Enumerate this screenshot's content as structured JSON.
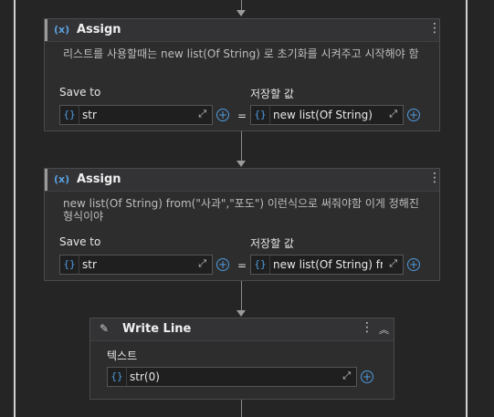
{
  "assign1": {
    "title": "Assign",
    "icon": "variable-x-icon",
    "description": "리스트를 사용할때는 new list(Of String) 로 초기화를 시켜주고 시작해야 함",
    "save_to_label": "Save to",
    "value_label": "저장할 값",
    "save_to_value": "str",
    "value": "new list(Of String)",
    "eq": "="
  },
  "assign2": {
    "title": "Assign",
    "icon": "variable-x-icon",
    "description": "new list(Of String) from(\"사과\",\"포도\") 이런식으로 써줘야함 이게 정해진 형식이야",
    "save_to_label": "Save to",
    "value_label": "저장할 값",
    "save_to_value": "str",
    "value": "new list(Of String) fro",
    "eq": "="
  },
  "writeline": {
    "title": "Write Line",
    "icon": "pencil-icon",
    "text_label": "텍스트",
    "text_value": "str(0)"
  },
  "glyphs": {
    "brace": "{}",
    "x": "(x)",
    "dots": "⋮",
    "expand": "⤢",
    "plus": "+",
    "collapse": "︽",
    "pencil": "✎"
  }
}
